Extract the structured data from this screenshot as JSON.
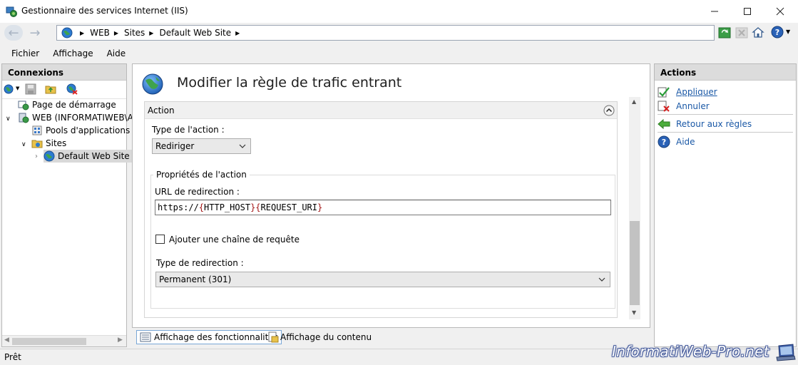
{
  "window": {
    "title": "Gestionnaire des services Internet (IIS)",
    "controls": [
      "minimize-icon",
      "maximize-icon",
      "close-icon"
    ]
  },
  "address": {
    "crumbs": [
      "WEB",
      "Sites",
      "Default Web Site"
    ]
  },
  "menu": [
    "Fichier",
    "Affichage",
    "Aide"
  ],
  "connections": {
    "header": "Connexions",
    "tree": [
      {
        "label": "Page de démarrage",
        "icon": "start-page-icon"
      },
      {
        "label": "WEB (INFORMATIWEB\\Ac",
        "icon": "server-icon"
      },
      {
        "label": "Pools d'applications",
        "icon": "app-pools-icon"
      },
      {
        "label": "Sites",
        "icon": "sites-folder-icon"
      },
      {
        "label": "Default Web Site",
        "icon": "globe-icon"
      }
    ]
  },
  "main": {
    "title": "Modifier la règle de trafic entrant",
    "section_header": "Action",
    "action_type_label": "Type de l'action :",
    "action_type_value": "Rediriger",
    "properties_group": "Propriétés de l'action",
    "url_label": "URL de redirection :",
    "url_parts": [
      "https://",
      "{",
      "HTTP_HOST",
      "}",
      "{",
      "REQUEST_URI",
      "}"
    ],
    "append_query_label": "Ajouter une chaîne de requête",
    "append_query_checked": false,
    "redirect_type_label": "Type de redirection :",
    "redirect_type_value": "Permanent (301)"
  },
  "view_tabs": [
    "Affichage des fonctionnalités",
    "Affichage du contenu"
  ],
  "actions": {
    "header": "Actions",
    "items": [
      "Appliquer",
      "Annuler",
      "Retour aux règles",
      "Aide"
    ]
  },
  "status": "Prêt",
  "watermark": "InformatiWeb-Pro.net",
  "colors": {
    "link": "#1a58a6",
    "brace": "#a31515",
    "panel_header": "#dcdcdc"
  }
}
